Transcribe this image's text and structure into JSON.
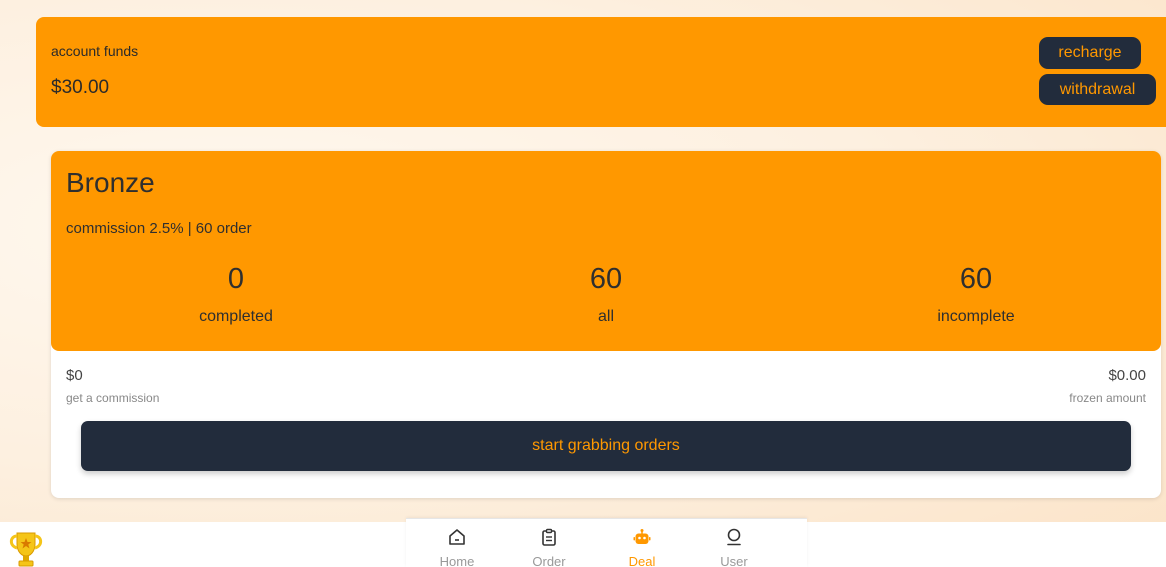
{
  "funds": {
    "label": "account funds",
    "amount": "$30.00",
    "recharge_label": "recharge",
    "withdrawal_label": "withdrawal"
  },
  "level": {
    "name": "Bronze",
    "description": "commission 2.5% | 60 order",
    "stats": [
      {
        "value": "0",
        "label": "completed"
      },
      {
        "value": "60",
        "label": "all"
      },
      {
        "value": "60",
        "label": "incomplete"
      }
    ],
    "commission_amount": "$0",
    "commission_label": "get a commission",
    "frozen_amount": "$0.00",
    "frozen_label": "frozen amount",
    "start_button_label": "start grabbing orders"
  },
  "tabbar": {
    "active": "Deal",
    "items": [
      {
        "label": "Home",
        "icon": "home-icon"
      },
      {
        "label": "Order",
        "icon": "clipboard-icon"
      },
      {
        "label": "Deal",
        "icon": "robot-icon"
      },
      {
        "label": "User",
        "icon": "user-icon"
      }
    ]
  },
  "colors": {
    "accent": "#ff9800",
    "dark": "#222c3c",
    "inactive_tab": "#999999"
  }
}
